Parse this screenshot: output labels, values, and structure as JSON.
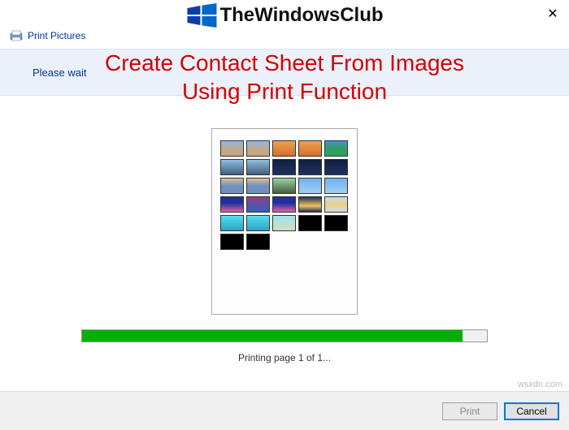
{
  "window": {
    "title": "Print Pictures",
    "close_glyph": "✕"
  },
  "brand": {
    "name": "TheWindowsClub",
    "colors": {
      "logo_left": "#0068c8",
      "logo_right": "#0a3fa8"
    }
  },
  "heading": {
    "line1": "Create Contact Sheet From Images",
    "line2": "Using Print Function"
  },
  "status": {
    "message": "Please wait"
  },
  "progress": {
    "percent": 94,
    "label": "Printing page 1 of 1..."
  },
  "buttons": {
    "print": "Print",
    "cancel": "Cancel"
  },
  "watermark": "wsxdn.com",
  "contact_sheet": {
    "rows": [
      [
        "t-sky",
        "t-sky",
        "t-sunset",
        "t-sunset",
        "t-tropical"
      ],
      [
        "t-mountain",
        "t-mountain",
        "t-night",
        "t-night",
        "t-night"
      ],
      [
        "t-lake",
        "t-lake",
        "t-forest",
        "t-bluesky",
        "t-bluesky"
      ],
      [
        "t-lights",
        "t-bridge",
        "t-lights",
        "t-city",
        "t-reflect"
      ],
      [
        "t-cyan",
        "t-cyan",
        "t-beach",
        "t-black",
        "t-black"
      ],
      [
        "t-black",
        "t-black"
      ]
    ]
  }
}
